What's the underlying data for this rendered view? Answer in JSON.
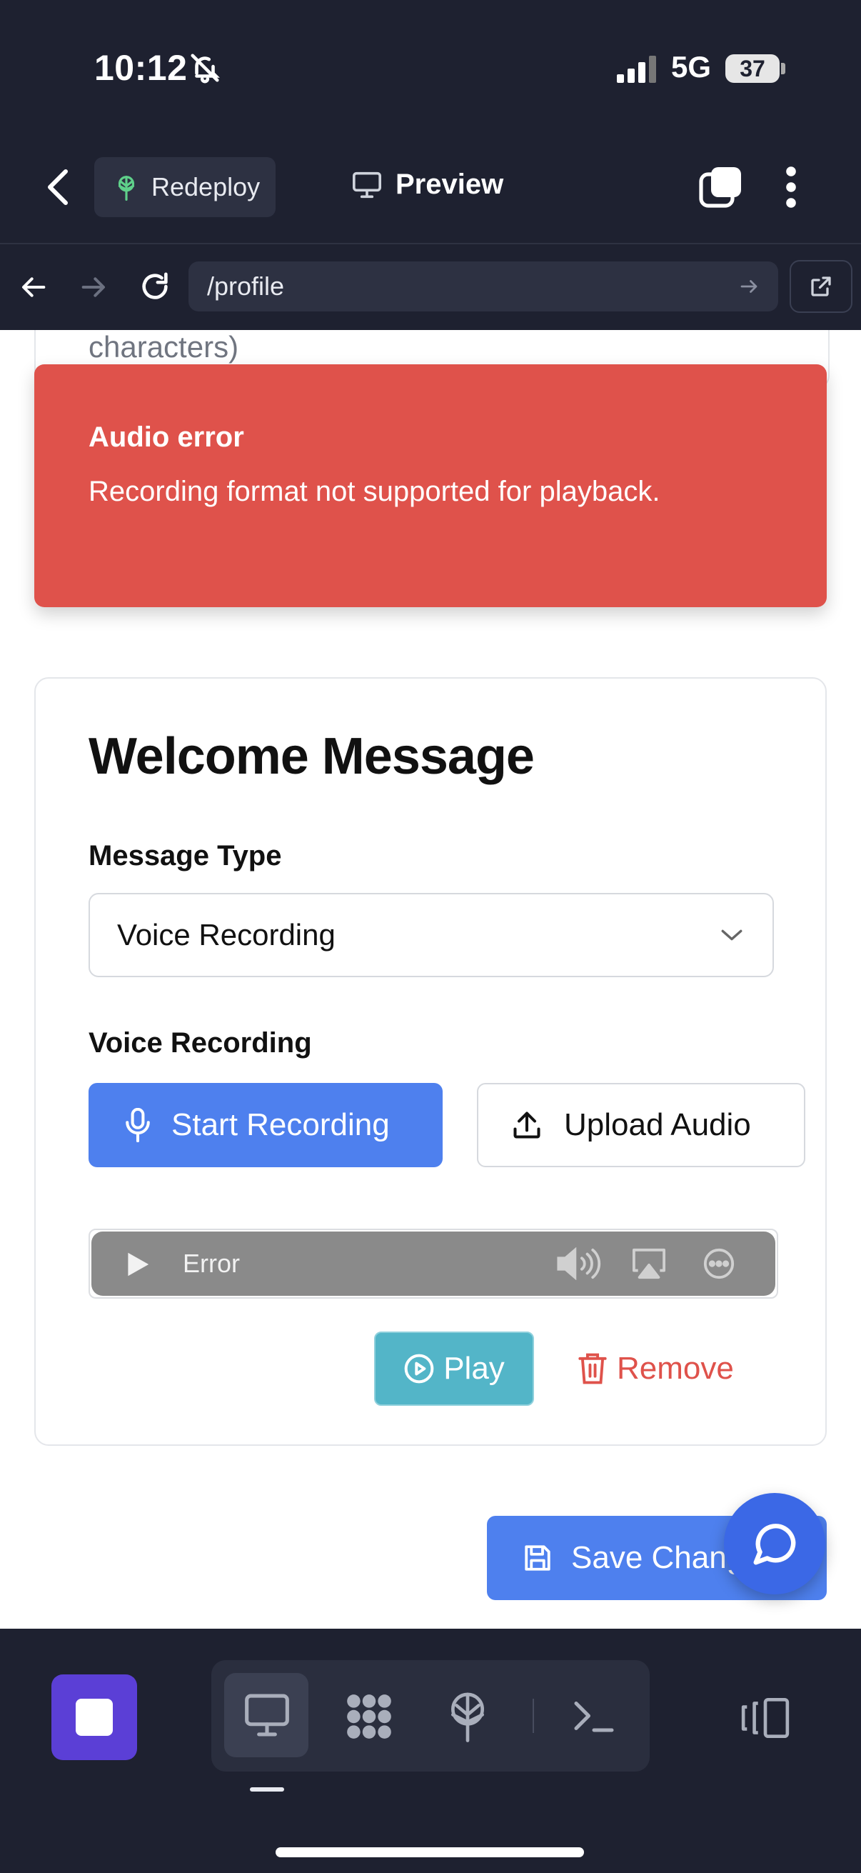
{
  "status_bar": {
    "time": "10:12",
    "network": "5G",
    "battery": "37"
  },
  "header": {
    "redeploy_label": "Redeploy",
    "preview_label": "Preview"
  },
  "url_bar": {
    "url": "/profile"
  },
  "previous_section": {
    "trailing_text": "characters)"
  },
  "toast": {
    "title": "Audio error",
    "message": "Recording format not supported for playback.",
    "color": "#df524b"
  },
  "welcome": {
    "title": "Welcome Message",
    "message_type_label": "Message Type",
    "message_type_value": "Voice Recording",
    "voice_label": "Voice Recording",
    "start_recording": "Start Recording",
    "upload_audio": "Upload Audio",
    "player_status": "Error",
    "play": "Play",
    "remove": "Remove"
  },
  "actions": {
    "save": "Save Changes"
  },
  "colors": {
    "primary": "#4e80ee",
    "play": "#53b5c8",
    "danger": "#df524b",
    "dark": "#1e2130",
    "app": "#5b3fd6"
  },
  "icons": [
    "bell-slash-icon",
    "signal-icon",
    "back-icon",
    "redeploy-icon",
    "monitor-icon",
    "copy-icon",
    "more-vertical-icon",
    "arrow-left-icon",
    "arrow-right-icon",
    "reload-icon",
    "external-link-icon",
    "chevron-down-icon",
    "mic-icon",
    "upload-icon",
    "play-icon",
    "volume-icon",
    "airplay-icon",
    "more-horizontal-icon",
    "play-circle-icon",
    "trash-icon",
    "save-icon",
    "chat-icon",
    "monitor-tool-icon",
    "nodes-icon",
    "deploy-icon",
    "terminal-icon",
    "panel-toggle-icon"
  ]
}
